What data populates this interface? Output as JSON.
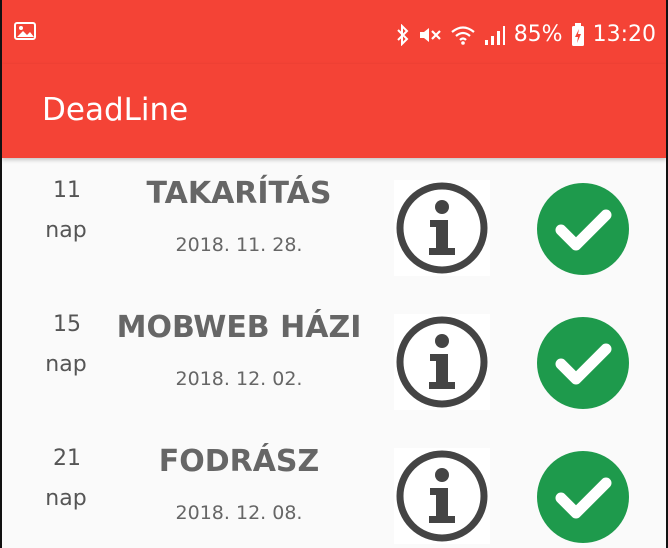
{
  "status_bar": {
    "battery_percent": "85%",
    "time": "13:20",
    "icons": [
      "image-icon",
      "bluetooth-icon",
      "mute-icon",
      "wifi-icon",
      "signal-icon",
      "battery-charging-icon"
    ]
  },
  "app_bar": {
    "title": "DeadLine",
    "color": "#f44336"
  },
  "tasks": [
    {
      "days": "11",
      "unit": "nap",
      "title": "TAKARÍTÁS",
      "date": "2018. 11. 28."
    },
    {
      "days": "15",
      "unit": "nap",
      "title": "MOBWEB HÁZI",
      "date": "2018. 12. 02."
    },
    {
      "days": "21",
      "unit": "nap",
      "title": "FODRÁSZ",
      "date": "2018. 12. 08."
    }
  ],
  "colors": {
    "accent": "#f44336",
    "done": "#1e9a4c",
    "info": "#444444"
  }
}
